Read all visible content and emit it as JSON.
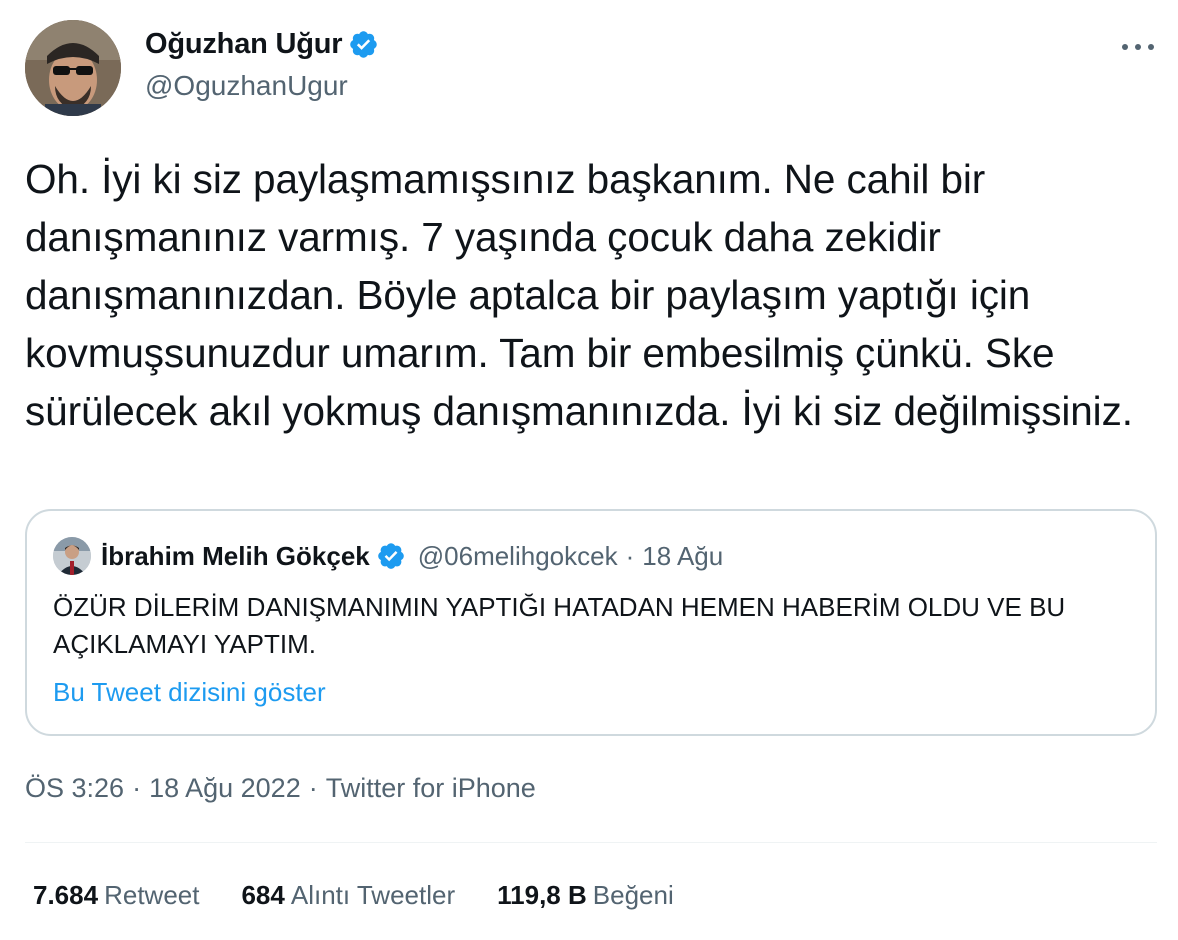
{
  "author": {
    "display_name": "Oğuzhan Uğur",
    "handle": "@OguzhanUgur",
    "verified": true
  },
  "tweet": {
    "text": "Oh. İyi ki siz paylaşmamışsınız başkanım. Ne cahil bir danışmanınız varmış. 7 yaşında çocuk daha zekidir danışmanınızdan. Böyle aptalca bir paylaşım yaptığı için kovmuşsunuzdur umarım. Tam bir embesilmiş çünkü. Ske sürülecek akıl yokmuş danışmanınızda. İyi ki siz değilmişsiniz."
  },
  "quoted_tweet": {
    "display_name": "İbrahim Melih Gökçek",
    "handle": "@06melihgokcek",
    "separator": "·",
    "date": "18 Ağu",
    "verified": true,
    "text": "ÖZÜR DİLERİM DANIŞMANIMIN YAPTIĞI HATADAN HEMEN HABERİM OLDU VE BU AÇIKLAMAYI YAPTIM.",
    "show_thread_label": "Bu Tweet dizisini göster"
  },
  "meta": {
    "time": "ÖS 3:26",
    "separator": "·",
    "date": "18 Ağu 2022",
    "source": "Twitter for iPhone"
  },
  "stats": {
    "retweets": {
      "count": "7.684",
      "label": "Retweet"
    },
    "quotes": {
      "count": "684",
      "label": "Alıntı Tweetler"
    },
    "likes": {
      "count": "119,8 B",
      "label": "Beğeni"
    }
  },
  "icons": {
    "verified": "verified-badge-icon",
    "more": "more-options-icon"
  },
  "colors": {
    "text_primary": "#0f1419",
    "text_secondary": "#536471",
    "accent": "#1d9bf0",
    "border": "#cfd9de"
  }
}
